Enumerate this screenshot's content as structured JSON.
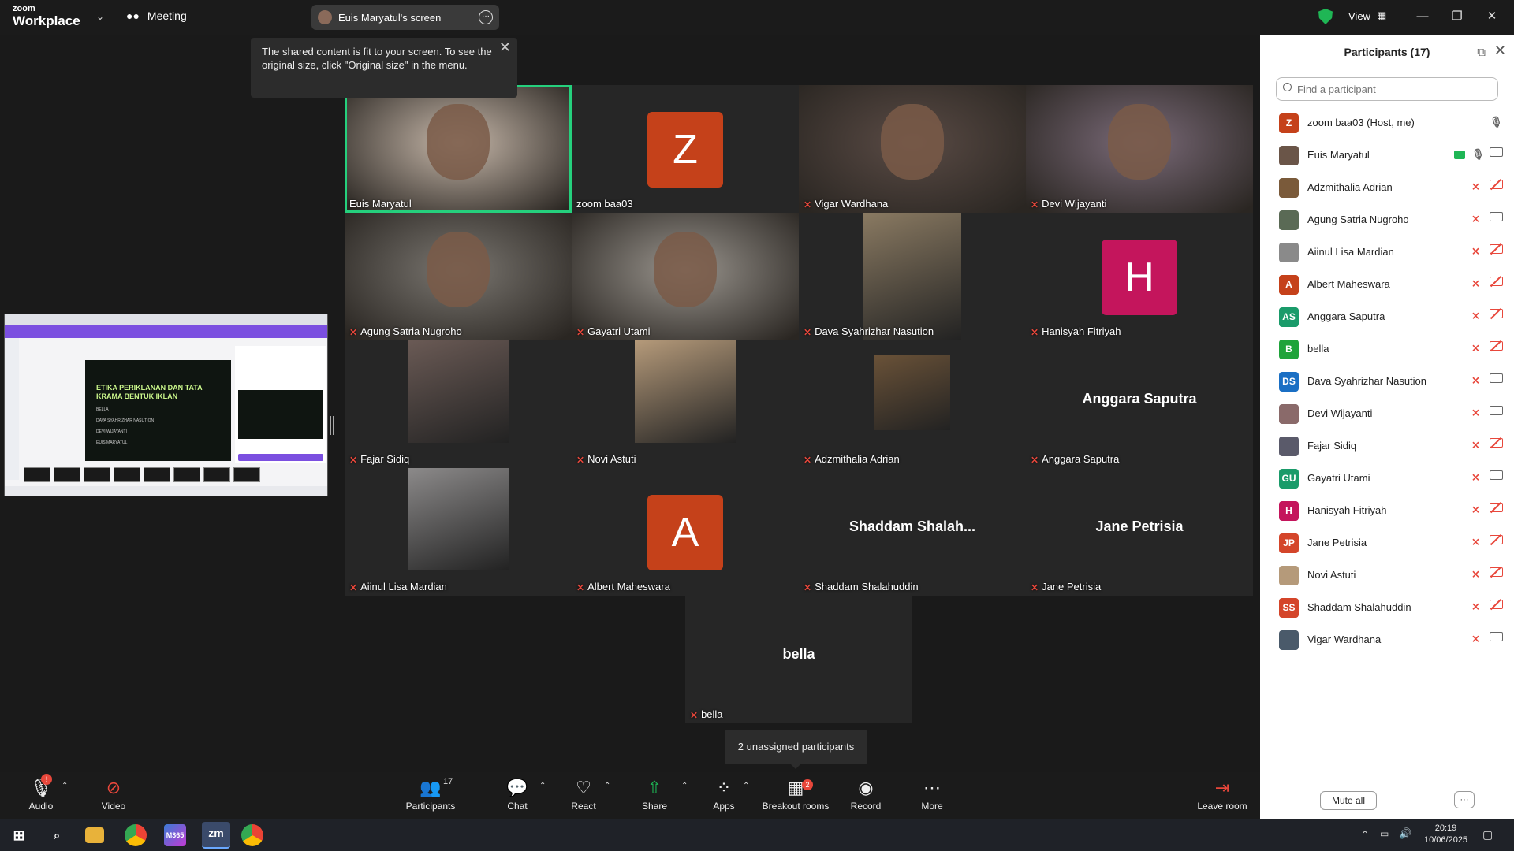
{
  "titlebar": {
    "logo_line1": "zoom",
    "logo_line2": "Workplace",
    "meeting_label": "Meeting",
    "screen_chip_label": "Euis Maryatul's screen",
    "view_label": "View"
  },
  "notice": {
    "text": "The shared content is fit to your screen. To see the original size, click \"Original size\" in the menu."
  },
  "shared_slide": {
    "title": "ETIKA PERIKLANAN DAN TATA KRAMA BENTUK IKLAN",
    "lines": [
      "BELLA",
      "DAVA SYAHRIZHAR NASUTION",
      "DEVI WIJAYANTI",
      "EUIS MARYATUL"
    ]
  },
  "gallery": {
    "tiles": [
      {
        "name": "Euis Maryatul",
        "kind": "video",
        "muted": false,
        "active": true,
        "tone": "#c7b8aa"
      },
      {
        "name": "zoom baa03",
        "kind": "avatar",
        "muted": false,
        "letter": "Z",
        "color": "#c5411a"
      },
      {
        "name": "Vigar Wardhana",
        "kind": "video",
        "muted": true,
        "tone": "#5a4b45"
      },
      {
        "name": "Devi Wijayanti",
        "kind": "video",
        "muted": true,
        "tone": "#7a6a78"
      },
      {
        "name": "Agung Satria Nugroho",
        "kind": "video",
        "muted": true,
        "tone": "#7a7670"
      },
      {
        "name": "Gayatri Utami",
        "kind": "video",
        "muted": true,
        "tone": "#9a958e"
      },
      {
        "name": "Dava Syahrizhar Nasution",
        "kind": "photo",
        "muted": true,
        "tone": "#8a7a62"
      },
      {
        "name": "Hanisyah Fitriyah",
        "kind": "avatar",
        "muted": true,
        "letter": "H",
        "color": "#c4155c"
      },
      {
        "name": "Fajar Sidiq",
        "kind": "photo",
        "muted": true,
        "tone": "#6a5a55"
      },
      {
        "name": "Novi Astuti",
        "kind": "photo",
        "muted": true,
        "tone": "#b59a7a"
      },
      {
        "name": "Adzmithalia Adrian",
        "kind": "photo",
        "muted": true,
        "tone": "#6a5238"
      },
      {
        "name": "Anggara Saputra",
        "kind": "text",
        "muted": true,
        "display": "Anggara Saputra"
      },
      {
        "name": "Aiinul Lisa Mardian",
        "kind": "photo",
        "muted": true,
        "tone": "#8c8a8a"
      },
      {
        "name": "Albert Maheswara",
        "kind": "avatar",
        "muted": true,
        "letter": "A",
        "color": "#c5411a"
      },
      {
        "name": "Shaddam Shalahuddin",
        "kind": "text",
        "muted": true,
        "display": "Shaddam  Shalah..."
      },
      {
        "name": "Jane Petrisia",
        "kind": "text",
        "muted": true,
        "display": "Jane Petrisia"
      }
    ],
    "bella": {
      "name": "bella",
      "display": "bella"
    },
    "unassigned": "2 unassigned participants"
  },
  "panel": {
    "title": "Participants (17)",
    "search_placeholder": "Find a participant",
    "mute_all": "Mute all",
    "participants": [
      {
        "name": "zoom baa03 (Host, me)",
        "initials": "Z",
        "color": "#c5411a",
        "mic": "on",
        "cam": "none"
      },
      {
        "name": "Euis Maryatul",
        "initials": "",
        "color": "#6a5548",
        "mic": "on",
        "cam": "on",
        "sharing": true
      },
      {
        "name": "Adzmithalia Adrian",
        "initials": "",
        "color": "#7a5a3a",
        "mic": "off",
        "cam": "off"
      },
      {
        "name": "Agung Satria Nugroho",
        "initials": "",
        "color": "#5a6a55",
        "mic": "off",
        "cam": "on"
      },
      {
        "name": "Aiinul Lisa Mardian",
        "initials": "",
        "color": "#8a8a8a",
        "mic": "off",
        "cam": "off"
      },
      {
        "name": "Albert Maheswara",
        "initials": "A",
        "color": "#c5411a",
        "mic": "off",
        "cam": "off"
      },
      {
        "name": "Anggara Saputra",
        "initials": "AS",
        "color": "#1a9b6a",
        "mic": "off",
        "cam": "off"
      },
      {
        "name": "bella",
        "initials": "B",
        "color": "#1fa33a",
        "mic": "off",
        "cam": "off"
      },
      {
        "name": "Dava Syahrizhar Nasution",
        "initials": "DS",
        "color": "#1a6fc4",
        "mic": "off",
        "cam": "on"
      },
      {
        "name": "Devi Wijayanti",
        "initials": "",
        "color": "#8a6a6a",
        "mic": "off",
        "cam": "on"
      },
      {
        "name": "Fajar Sidiq",
        "initials": "",
        "color": "#5a5a6a",
        "mic": "off",
        "cam": "off"
      },
      {
        "name": "Gayatri Utami",
        "initials": "GU",
        "color": "#1a9b6a",
        "mic": "off",
        "cam": "on"
      },
      {
        "name": "Hanisyah Fitriyah",
        "initials": "H",
        "color": "#c4155c",
        "mic": "off",
        "cam": "off"
      },
      {
        "name": "Jane Petrisia",
        "initials": "JP",
        "color": "#d4452a",
        "mic": "off",
        "cam": "off"
      },
      {
        "name": "Novi Astuti",
        "initials": "",
        "color": "#b59a7a",
        "mic": "off",
        "cam": "off"
      },
      {
        "name": "Shaddam Shalahuddin",
        "initials": "SS",
        "color": "#d4452a",
        "mic": "off",
        "cam": "off"
      },
      {
        "name": "Vigar Wardhana",
        "initials": "",
        "color": "#4a5a6a",
        "mic": "off",
        "cam": "on"
      }
    ]
  },
  "toolbar": {
    "audio": "Audio",
    "video": "Video",
    "participants": "Participants",
    "participants_count": "17",
    "chat": "Chat",
    "react": "React",
    "share": "Share",
    "apps": "Apps",
    "breakout": "Breakout rooms",
    "breakout_badge": "2",
    "record": "Record",
    "more": "More",
    "leave": "Leave room"
  },
  "taskbar": {
    "time": "20:19",
    "date": "10/06/2025"
  },
  "colors": {
    "accent_green": "#25d07d",
    "muted_red": "#e8473b"
  }
}
